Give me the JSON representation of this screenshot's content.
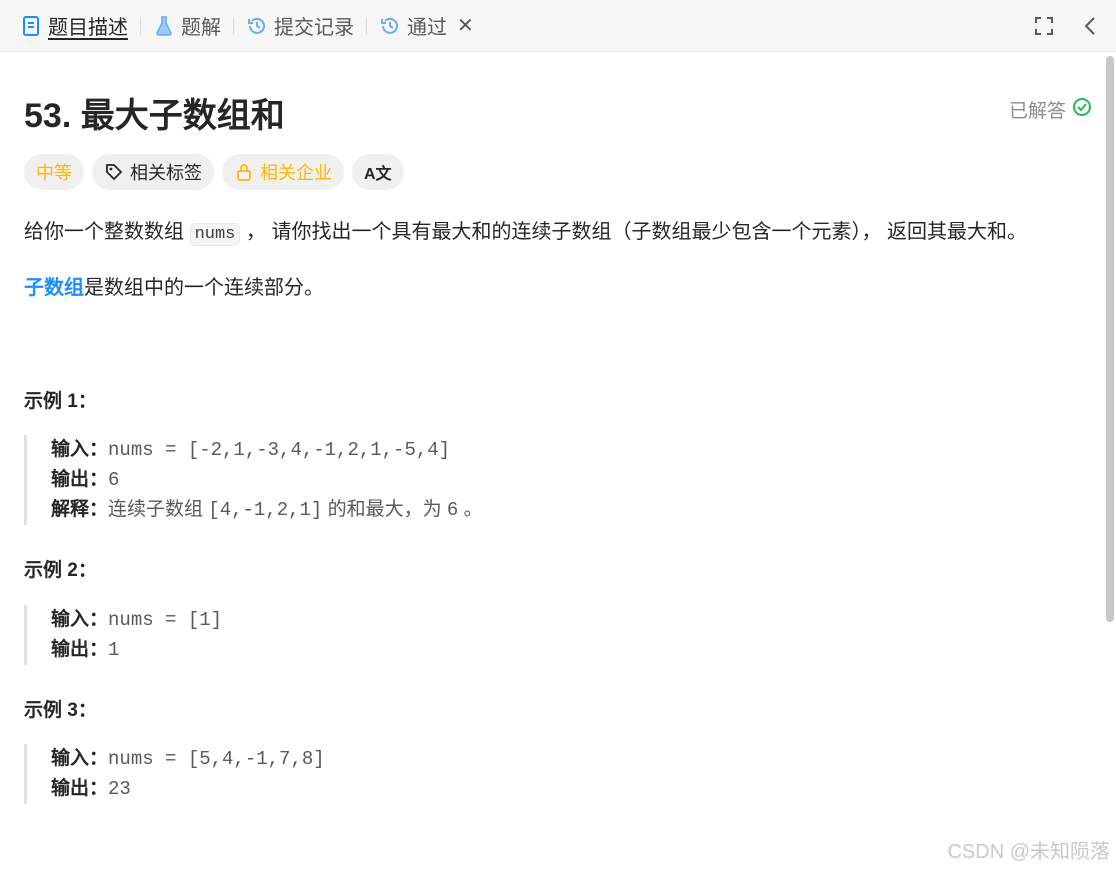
{
  "tabs": [
    {
      "label": "题目描述",
      "icon": "document-icon"
    },
    {
      "label": "题解",
      "icon": "flask-icon"
    },
    {
      "label": "提交记录",
      "icon": "history-icon"
    },
    {
      "label": "通过",
      "icon": "history-icon"
    }
  ],
  "problem": {
    "title": "53. 最大子数组和",
    "status": "已解答"
  },
  "tags": {
    "difficulty": "中等",
    "related_tags": "相关标签",
    "related_companies": "相关企业",
    "translate": "A文"
  },
  "description": {
    "part1": "给你一个整数数组 ",
    "code": "nums",
    "part2": " ， 请你找出一个具有最大和的连续子数组（子数组最少包含一个元素）， 返回其最大和。",
    "subarray_link": "子数组",
    "subarray_rest": "是数组中的一个连续部分。"
  },
  "examples": [
    {
      "title": "示例 1：",
      "input_label": "输入：",
      "input": "nums = [-2,1,-3,4,-1,2,1,-5,4]",
      "output_label": "输出：",
      "output": "6",
      "explain_label": "解释：",
      "explain_text": "连续子数组 ",
      "explain_code": "[4,-1,2,1]",
      "explain_text2": " 的和最大，为 ",
      "explain_code2": "6",
      "explain_text3": " 。"
    },
    {
      "title": "示例 2：",
      "input_label": "输入：",
      "input": "nums = [1]",
      "output_label": "输出：",
      "output": "1"
    },
    {
      "title": "示例 3：",
      "input_label": "输入：",
      "input": "nums = [5,4,-1,7,8]",
      "output_label": "输出：",
      "output": "23"
    }
  ],
  "watermark": "CSDN @未知陨落",
  "colors": {
    "accent": "#1a90ff",
    "medium": "#ffb800",
    "solved": "#2db55d"
  }
}
